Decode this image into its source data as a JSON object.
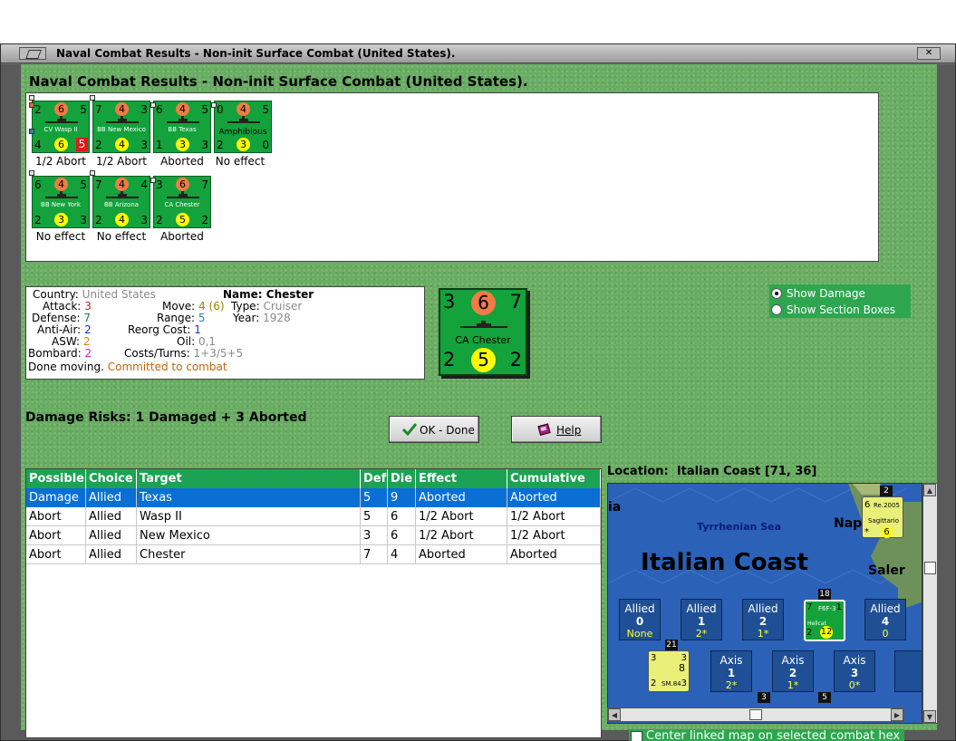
{
  "window": {
    "title": "Naval Combat Results - Non-init Surface Combat (United States).",
    "heading": "Naval Combat Results - Non-init Surface Combat (United States)."
  },
  "units": [
    {
      "name": "CV Wasp II",
      "tl": "2",
      "circ_top": "6",
      "tr": "5",
      "bl": "4",
      "circ_bot": "6",
      "br": "5",
      "result": "1/2 Abort",
      "top_color": "orange",
      "bot_color": "yellow"
    },
    {
      "name": "BB New Mexico",
      "tl": "7",
      "circ_top": "4",
      "tr": "3",
      "bl": "2",
      "circ_bot": "4",
      "br": "3",
      "result": "1/2 Abort",
      "top_color": "orange",
      "bot_color": "yellow"
    },
    {
      "name": "BB Texas",
      "tl": "6",
      "circ_top": "4",
      "tr": "5",
      "bl": "1",
      "circ_bot": "3",
      "br": "3",
      "result": "Aborted",
      "top_color": "orange",
      "bot_color": "yellow"
    },
    {
      "name": "Amphibious",
      "tl": "0",
      "circ_top": "4",
      "tr": "5",
      "bl": "2",
      "circ_bot": "3",
      "br": "0",
      "result": "No effect",
      "top_color": "orange",
      "bot_color": "yellow"
    },
    {
      "name": "BB New York",
      "tl": "6",
      "circ_top": "4",
      "tr": "5",
      "bl": "2",
      "circ_bot": "3",
      "br": "3",
      "result": "No effect",
      "top_color": "orange",
      "bot_color": "yellow"
    },
    {
      "name": "BB Arizona",
      "tl": "7",
      "circ_top": "4",
      "tr": "4",
      "bl": "2",
      "circ_bot": "4",
      "br": "3",
      "result": "No effect",
      "top_color": "orange",
      "bot_color": "yellow"
    },
    {
      "name": "CA Chester",
      "tl": "3",
      "circ_top": "6",
      "tr": "7",
      "bl": "2",
      "circ_bot": "5",
      "br": "2",
      "result": "Aborted",
      "top_color": "orange",
      "bot_color": "yellow"
    }
  ],
  "info": {
    "country_label": "Country:",
    "country": "United States",
    "attack_label": "Attack:",
    "attack": "3",
    "defense_label": "Defense:",
    "defense": "7",
    "antiair_label": "Anti-Air:",
    "antiair": "2",
    "asw_label": "ASW:",
    "asw": "2",
    "bombard_label": "Bombard:",
    "bombard": "2",
    "done_label": "Done moving.",
    "done_status": "Committed to combat",
    "move_label": "Move:",
    "move": "4",
    "move_extra": "(6)",
    "range_label": "Range:",
    "range": "5",
    "reorg_label": "Reorg Cost:",
    "reorg": "1",
    "oil_label": "Oil:",
    "oil": "0,1",
    "costs_label": "Costs/Turns:",
    "costs": "1+3/5+5",
    "name_label": "Name:",
    "name": "Chester",
    "type_label": "Type:",
    "type": "Cruiser",
    "year_label": "Year:",
    "year": "1928"
  },
  "big_counter": {
    "tl": "3",
    "circ_top": "6",
    "tr": "7",
    "name": "CA Chester",
    "bl": "2",
    "circ_bot": "5",
    "br": "2"
  },
  "options": {
    "show_damage": "Show Damage",
    "show_section_boxes": "Show Section Boxes"
  },
  "damage_risks": "Damage Risks: 1 Damaged + 3 Aborted",
  "buttons": {
    "ok": "OK - Done",
    "help": "Help"
  },
  "table": {
    "headers": [
      "Possible",
      "Choice",
      "Target",
      "Def",
      "Die",
      "Effect",
      "Cumulative"
    ],
    "rows": [
      [
        "Damage",
        "Allied",
        "Texas",
        "5",
        "9",
        "Aborted",
        "Aborted"
      ],
      [
        "Abort",
        "Allied",
        "Wasp II",
        "5",
        "6",
        "1/2 Abort",
        "1/2 Abort"
      ],
      [
        "Abort",
        "Allied",
        "New Mexico",
        "3",
        "6",
        "1/2 Abort",
        "1/2 Abort"
      ],
      [
        "Abort",
        "Allied",
        "Chester",
        "7",
        "4",
        "Aborted",
        "Aborted"
      ]
    ]
  },
  "location": {
    "label": "Location:",
    "value": "Italian Coast [71, 36]"
  },
  "map": {
    "sea_name": "Tyrrhenian Sea",
    "coast_name": "Italian Coast",
    "place_ia": "ia",
    "place_napl": "Napl",
    "place_saler": "Saler",
    "allied_label": "Allied",
    "axis_label": "Axis",
    "allied_boxes": [
      {
        "num": "0",
        "sub": "None"
      },
      {
        "num": "1",
        "sub": "2*"
      },
      {
        "num": "2",
        "sub": "1*"
      },
      {
        "num": "4",
        "sub": "0"
      }
    ],
    "axis_boxes": [
      {
        "num": "1",
        "sub": "2*"
      },
      {
        "num": "2",
        "sub": "1*"
      },
      {
        "num": "3",
        "sub": "0*"
      }
    ],
    "stack_badges": [
      "2",
      "18",
      "21",
      "3",
      "5"
    ],
    "unit_re2005": {
      "name": "Re.2005",
      "sub": "Sagittario",
      "tl": "6",
      "br": "6",
      "star": "*"
    },
    "unit_f6f3": {
      "name": "F6F-3",
      "sub": "Hellcat",
      "tl": "7",
      "tr": "1",
      "bl": "2",
      "circ": "12"
    },
    "unit_sm84": {
      "name": "SM.84",
      "tl": "3",
      "tr": "3",
      "circ": "8",
      "bl": "2",
      "br": "3"
    }
  },
  "center_linked": "Center linked map on selected combat hex",
  "colors": {
    "felt": "#69ad63",
    "counter_green": "#13a23b",
    "header_green": "#1ba353",
    "selection_blue": "#0a6fd4"
  }
}
